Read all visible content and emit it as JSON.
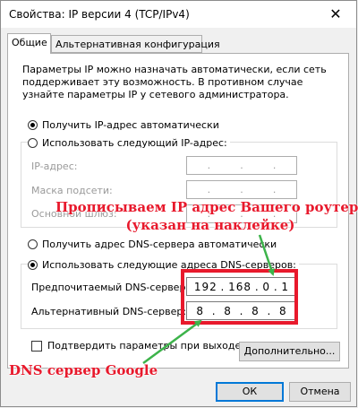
{
  "window": {
    "title": "Свойства: IP версии 4 (TCP/IPv4)",
    "close_glyph": "✕"
  },
  "tabs": [
    {
      "label": "Общие",
      "active": true
    },
    {
      "label": "Альтернативная конфигурация",
      "active": false
    }
  ],
  "general": {
    "description": "Параметры IP можно назначать автоматически, если сеть поддерживает эту возможность. В противном случае узнайте параметры IP у сетевого администратора.",
    "ip_auto_label": "Получить IP-адрес автоматически",
    "ip_manual_label": "Использовать следующий IP-адрес:",
    "ip_address_label": "IP-адрес:",
    "subnet_label": "Маска подсети:",
    "gateway_label": "Основной шлюз:",
    "dns_auto_label": "Получить адрес DNS-сервера автоматически",
    "dns_manual_label": "Использовать следующие адреса DNS-серверов:",
    "preferred_dns_label": "Предпочитаемый DNS-сервер:",
    "preferred_dns": [
      "192",
      "168",
      "0",
      "1"
    ],
    "alternate_dns_label": "Альтернативный DNS-сервер:",
    "alternate_dns": [
      "8",
      "8",
      "8",
      "8"
    ],
    "dot": ".",
    "validate_label": "Подтвердить параметры при выходе",
    "advanced_button": "Дополнительно..."
  },
  "buttons": {
    "ok": "ОК",
    "cancel": "Отмена"
  },
  "annotations": {
    "router_line1": "Прописываем IP адрес Вашего роутера",
    "router_line2": "(указан на наклейке)",
    "google_dns": "DNS сервер Google",
    "color": "#e8192c",
    "arrow_color": "#3cb34a"
  }
}
